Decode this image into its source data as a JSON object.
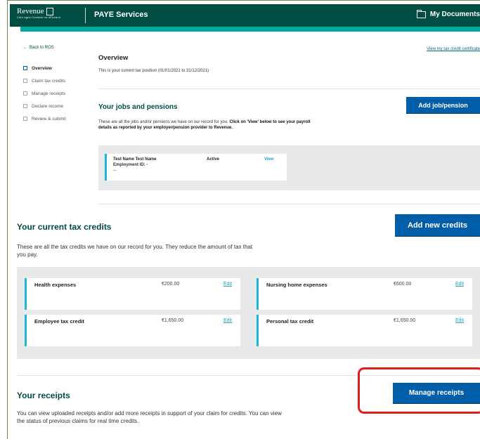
{
  "header": {
    "logo_text": "Revenue",
    "logo_subtext": "Cáin agus Custaim na hÉireann",
    "title": "PAYE Services",
    "my_documents": "My Documents"
  },
  "sidebar": {
    "back_link": "Back to ROS",
    "items": [
      {
        "label": "Overview"
      },
      {
        "label": "Claim tax credits"
      },
      {
        "label": "Manage receipts"
      },
      {
        "label": "Declare income"
      },
      {
        "label": "Review & submit"
      }
    ]
  },
  "overview": {
    "title": "Overview",
    "subtitle": "This is your current tax position (01/01/2021 to 31/12/2021)",
    "cert_link": "View my tax credit certificate"
  },
  "jobs": {
    "title": "Your jobs and pensions",
    "add_button": "Add job/pension",
    "desc_before": "These are all the jobs and/or pensions we have on our record for you.",
    "desc_bold": "Click on 'View' below to see your payroll details as reported by your employer/pension provider to Revenue.",
    "card": {
      "name": "Test Name Test Name",
      "employment_id": "Employment ID: -",
      "dash": "--",
      "status": "Active",
      "view": "View"
    }
  },
  "credits": {
    "title": "Your current tax credits",
    "add_button": "Add new credits",
    "desc": "These are all the tax credits we have on our record for you. They reduce the amount of tax that you pay.",
    "items": [
      {
        "name": "Health expenses",
        "amount": "€200.00",
        "edit": "Edit"
      },
      {
        "name": "Nursing home expenses",
        "amount": "€600.00",
        "edit": "Edit"
      },
      {
        "name": "Employee tax credit",
        "amount": "€1,650.00",
        "edit": "Edit"
      },
      {
        "name": "Personal tax credit",
        "amount": "€1,650.00",
        "edit": "Edit"
      }
    ]
  },
  "receipts": {
    "title": "Your receipts",
    "manage_button": "Manage receipts",
    "desc": "You can view uploaded receipts and/or add more receipts in support of your claim for credits. You can view the status of previous claims for real time credits."
  },
  "colors": {
    "header_bg": "#004d44",
    "header_accent": "#00a99d",
    "button_blue": "#005ea8",
    "card_accent": "#1fb6d6",
    "highlight_red": "#e21b1b"
  }
}
